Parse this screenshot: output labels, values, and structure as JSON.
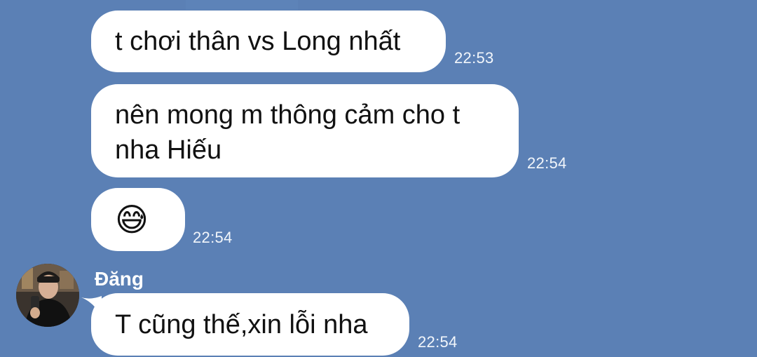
{
  "chat": {
    "messages": [
      {
        "text": "t chơi thân vs Long nhất",
        "time": "22:53"
      },
      {
        "text_line1": "nên mong m thông cảm cho t",
        "text_line2": "nha Hiếu",
        "time": "22:54"
      },
      {
        "emoji": "😅",
        "emoji_name": "grinning-face-with-sweat-icon",
        "time": "22:54"
      },
      {
        "sender": "Đăng",
        "text": "T cũng thế,xin lỗi nha",
        "time": "22:54"
      }
    ]
  },
  "colors": {
    "background": "#5b80b5",
    "bubble": "#ffffff",
    "message_text": "#111111",
    "timestamp": "#f2f6fb",
    "sender_name": "#ffffff"
  }
}
